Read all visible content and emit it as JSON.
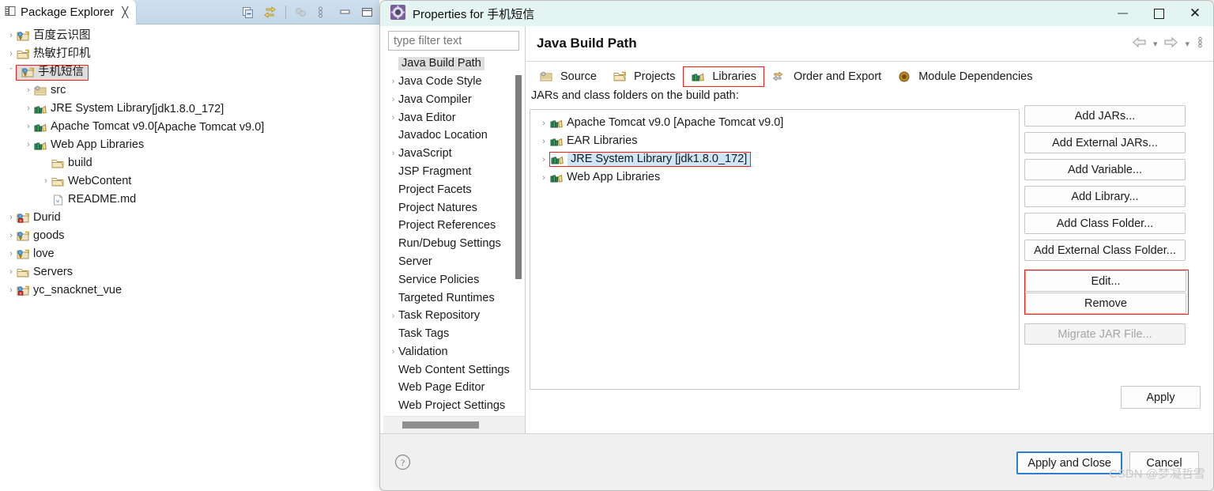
{
  "package_explorer": {
    "tab_label": "Package Explorer",
    "close_glyph": "╳",
    "toolbar": [
      {
        "name": "collapse-all-icon"
      },
      {
        "name": "link-with-editor-icon"
      },
      {
        "name": "view-filter-icon"
      },
      {
        "name": "view-menu-icon"
      },
      {
        "name": "minimize-icon"
      },
      {
        "name": "maximize-icon"
      }
    ],
    "tree": [
      {
        "arrow": "›",
        "icon": "java-project-warning-icon",
        "label": "百度云识图",
        "indent": 0,
        "selected": false
      },
      {
        "arrow": "›",
        "icon": "project-folder-icon",
        "label": "热敏打印机",
        "indent": 0,
        "selected": false
      },
      {
        "arrow": "ˇ",
        "icon": "java-project-warning-icon",
        "label": "手机短信",
        "indent": 0,
        "selected": true,
        "marked": true
      },
      {
        "arrow": "›",
        "icon": "source-folder-icon",
        "label": "src",
        "indent": 1,
        "selected": false
      },
      {
        "arrow": "›",
        "icon": "library-icon",
        "label": "JRE System Library ",
        "dim": "[jdk1.8.0_172]",
        "indent": 1,
        "selected": false
      },
      {
        "arrow": "›",
        "icon": "library-icon",
        "label": "Apache Tomcat v9.0 ",
        "dim": "[Apache Tomcat v9.0]",
        "indent": 1,
        "selected": false
      },
      {
        "arrow": "›",
        "icon": "library-icon",
        "label": "Web App Libraries",
        "indent": 1,
        "selected": false
      },
      {
        "arrow": "",
        "icon": "folder-icon",
        "label": "build",
        "indent": 2,
        "selected": false
      },
      {
        "arrow": "›",
        "icon": "folder-icon",
        "label": "WebContent",
        "indent": 2,
        "selected": false
      },
      {
        "arrow": "",
        "icon": "markdown-file-icon",
        "label": "README.md",
        "indent": 2,
        "selected": false
      },
      {
        "arrow": "›",
        "icon": "java-project-error-icon",
        "label": "Durid",
        "indent": 0,
        "selected": false
      },
      {
        "arrow": "›",
        "icon": "java-project-warning-icon",
        "label": "goods",
        "indent": 0,
        "selected": false
      },
      {
        "arrow": "›",
        "icon": "java-project-warning-icon",
        "label": "love",
        "indent": 0,
        "selected": false
      },
      {
        "arrow": "›",
        "icon": "folder-icon",
        "label": "Servers",
        "indent": 0,
        "selected": false
      },
      {
        "arrow": "›",
        "icon": "java-project-error-icon",
        "label": "yc_snacknet_vue",
        "indent": 0,
        "selected": false
      }
    ]
  },
  "dialog": {
    "title": "Properties for 手机短信",
    "window_controls": {
      "minimize": "–",
      "maximize": "□",
      "close": "✕"
    },
    "filter": {
      "placeholder": "type filter text",
      "value": ""
    },
    "settings_tree": [
      {
        "arrow": "",
        "label": "Java Build Path",
        "selected": true
      },
      {
        "arrow": "›",
        "label": "Java Code Style",
        "selected": false
      },
      {
        "arrow": "›",
        "label": "Java Compiler",
        "selected": false
      },
      {
        "arrow": "›",
        "label": "Java Editor",
        "selected": false
      },
      {
        "arrow": "",
        "label": "Javadoc Location",
        "selected": false
      },
      {
        "arrow": "›",
        "label": "JavaScript",
        "selected": false
      },
      {
        "arrow": "",
        "label": "JSP Fragment",
        "selected": false
      },
      {
        "arrow": "",
        "label": "Project Facets",
        "selected": false
      },
      {
        "arrow": "",
        "label": "Project Natures",
        "selected": false
      },
      {
        "arrow": "",
        "label": "Project References",
        "selected": false
      },
      {
        "arrow": "",
        "label": "Run/Debug Settings",
        "selected": false
      },
      {
        "arrow": "",
        "label": "Server",
        "selected": false
      },
      {
        "arrow": "",
        "label": "Service Policies",
        "selected": false
      },
      {
        "arrow": "",
        "label": "Targeted Runtimes",
        "selected": false
      },
      {
        "arrow": "›",
        "label": "Task Repository",
        "selected": false
      },
      {
        "arrow": "",
        "label": "Task Tags",
        "selected": false
      },
      {
        "arrow": "›",
        "label": "Validation",
        "selected": false
      },
      {
        "arrow": "",
        "label": "Web Content Settings",
        "selected": false
      },
      {
        "arrow": "",
        "label": "Web Page Editor",
        "selected": false
      },
      {
        "arrow": "",
        "label": "Web Project Settings",
        "selected": false
      }
    ],
    "page": {
      "title": "Java Build Path",
      "nav": {
        "back": "⇦",
        "back_menu": "▾",
        "forward": "⇨",
        "forward_menu": "▾",
        "menu": "⋮"
      },
      "tabs": [
        {
          "label": "Source",
          "icon": "source-folder-icon",
          "active": false,
          "marked": false
        },
        {
          "label": "Projects",
          "icon": "project-folder-icon",
          "active": false,
          "marked": false
        },
        {
          "label": "Libraries",
          "icon": "library-icon",
          "active": true,
          "marked": true
        },
        {
          "label": "Order and Export",
          "icon": "order-export-icon",
          "active": false,
          "marked": false
        },
        {
          "label": "Module Dependencies",
          "icon": "module-icon",
          "active": false,
          "marked": false
        }
      ],
      "list_label": "JARs and class folders on the build path:",
      "libraries": [
        {
          "arrow": "›",
          "label": "Apache Tomcat v9.0 [Apache Tomcat v9.0]",
          "selected": false,
          "marked": false
        },
        {
          "arrow": "›",
          "label": "EAR Libraries",
          "selected": false,
          "marked": false
        },
        {
          "arrow": "›",
          "label": "JRE System Library [jdk1.8.0_172]",
          "selected": true,
          "marked": true
        },
        {
          "arrow": "›",
          "label": "Web App Libraries",
          "selected": false,
          "marked": false
        }
      ],
      "buttons": [
        {
          "label": "Add JARs...",
          "disabled": false
        },
        {
          "label": "Add External JARs...",
          "disabled": false
        },
        {
          "label": "Add Variable...",
          "disabled": false
        },
        {
          "label": "Add Library...",
          "disabled": false
        },
        {
          "label": "Add Class Folder...",
          "disabled": false
        },
        {
          "label": "Add External Class Folder...",
          "disabled": false
        }
      ],
      "marked_buttons": [
        {
          "label": "Edit...",
          "disabled": false
        },
        {
          "label": "Remove",
          "disabled": false
        }
      ],
      "migrate_button": {
        "label": "Migrate JAR File...",
        "disabled": true
      },
      "apply_button": {
        "label": "Apply"
      }
    },
    "footer": {
      "help_icon": "help-icon",
      "apply_and_close": "Apply and Close",
      "cancel": "Cancel"
    }
  },
  "watermark": "CSDN @梦凝哲雪",
  "colors": {
    "dialog_titlebar": "#e3f4f1",
    "annotation_red": "#ff1a1a",
    "selection_blue": "#cfe6f7",
    "selection_gray": "#dedede",
    "focus_blue": "#2a7fd4",
    "tab_strip": "#c3d7e9"
  }
}
